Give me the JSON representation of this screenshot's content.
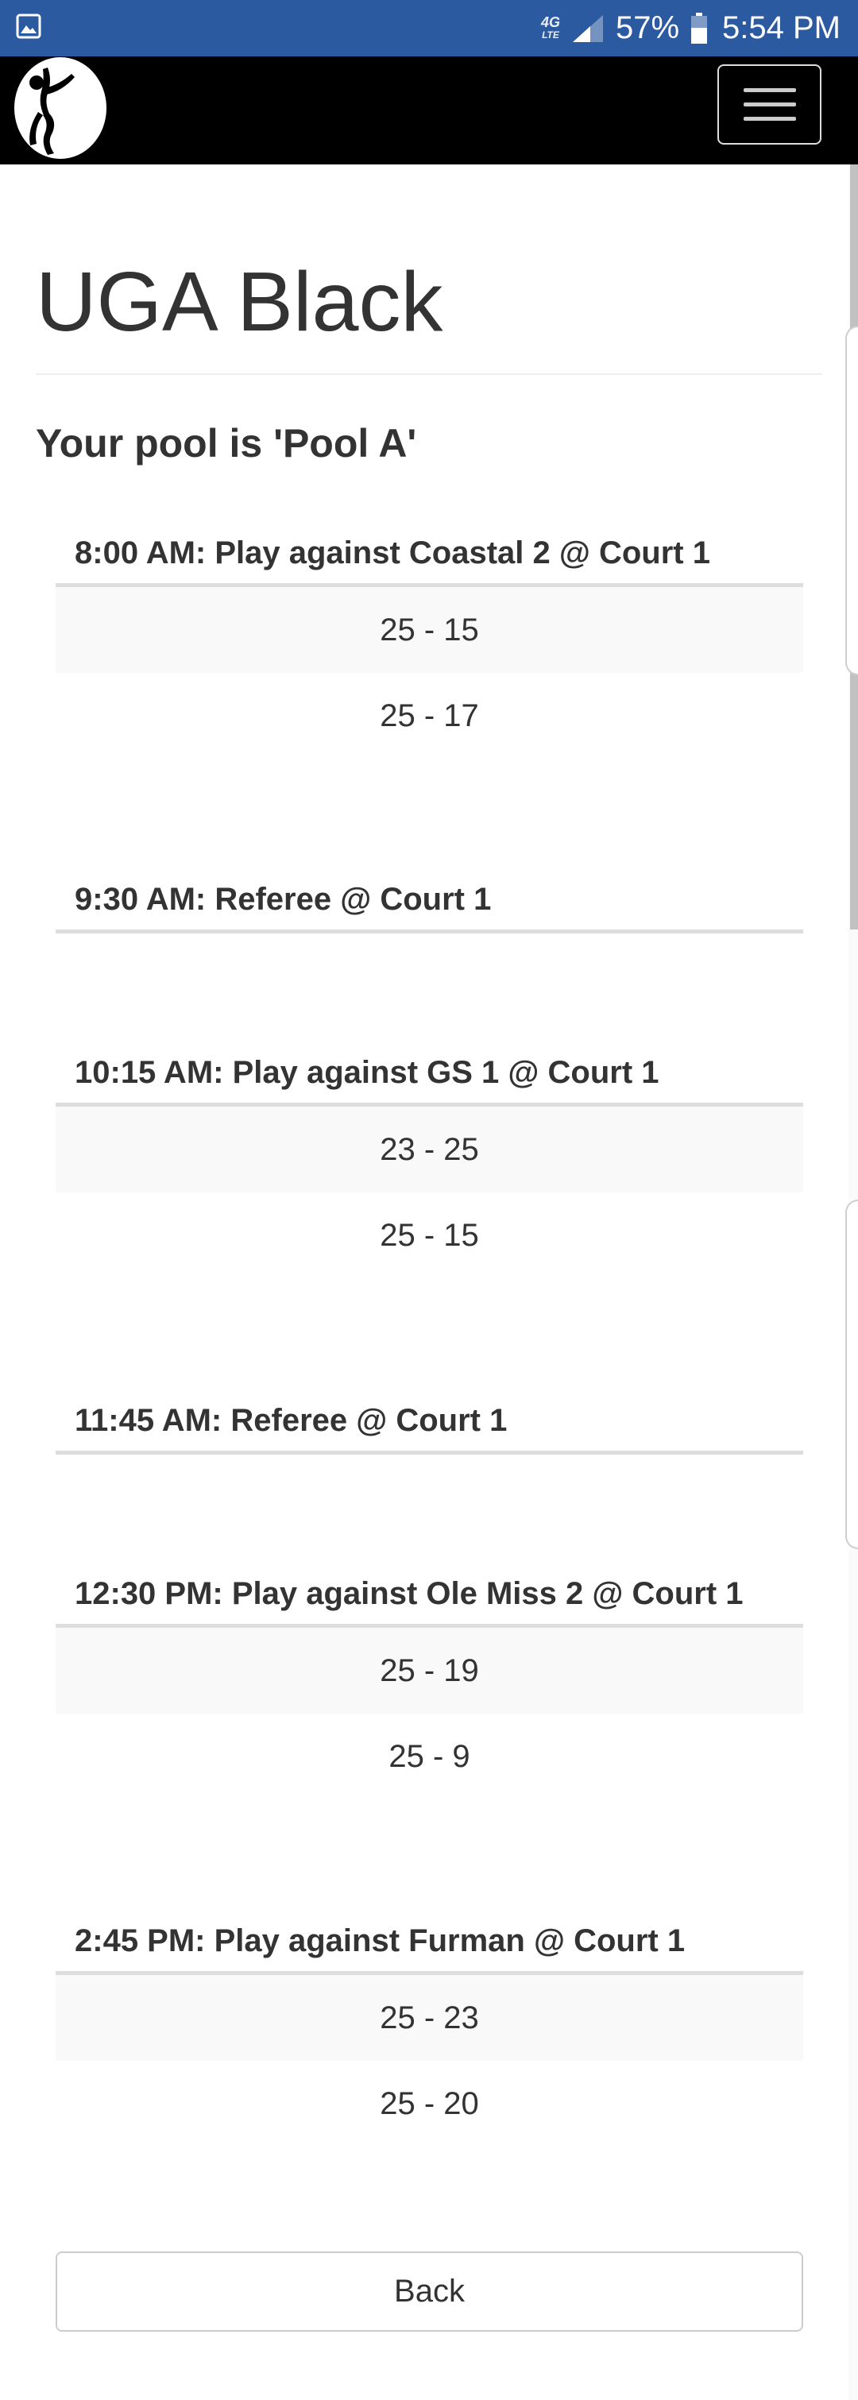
{
  "status_bar": {
    "network": "4G",
    "network_sub": "LTE",
    "battery_percent": "57%",
    "time": "5:54 PM",
    "battery_level": 0.57
  },
  "navbar": {
    "logo_icon": "volleyball-player-logo",
    "menu_icon": "hamburger-menu-icon"
  },
  "page": {
    "title": "UGA Black",
    "pool_text": "Your pool is 'Pool A'",
    "back_label": "Back"
  },
  "schedule": [
    {
      "heading": "8:00 AM: Play against Coastal 2 @ Court 1",
      "scores": [
        "25 - 15",
        "25 - 17"
      ]
    },
    {
      "heading": "9:30 AM: Referee @ Court 1",
      "scores": []
    },
    {
      "heading": "10:15 AM: Play against GS 1 @ Court 1",
      "scores": [
        "23 - 25",
        "25 - 15"
      ]
    },
    {
      "heading": "11:45 AM: Referee @ Court 1",
      "scores": []
    },
    {
      "heading": "12:30 PM: Play against Ole Miss 2 @ Court 1",
      "scores": [
        "25 - 19",
        "25 - 9"
      ]
    },
    {
      "heading": "2:45 PM: Play against Furman @ Court 1",
      "scores": [
        "25 - 23",
        "25 - 20"
      ]
    }
  ],
  "colors": {
    "status_bar": "#2c5aa0",
    "navbar": "#000000",
    "striped_row": "#f9f9f9",
    "rule": "#dddddd"
  }
}
